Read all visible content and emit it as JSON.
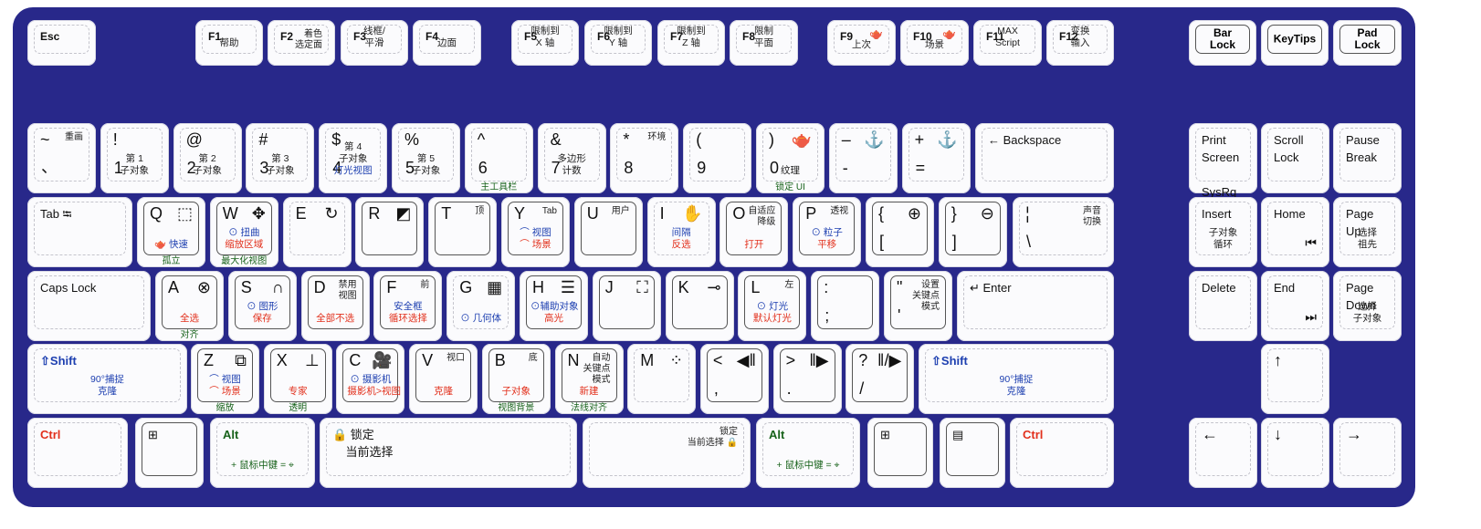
{
  "colors": {
    "board": "#28288a",
    "blue": "#1d3fb0",
    "red": "#e2301c",
    "green": "#17621a",
    "black": "#222222"
  },
  "icons": {
    "teapot": "🫖",
    "anchor": "⚓",
    "select": "⬚",
    "move": "✥",
    "rotate": "↻",
    "scale": "◩",
    "hand": "✋",
    "zoom-in": "⊕",
    "zoom-out": "⊖",
    "snap": "⊗",
    "magnet": "∩",
    "grid": "▦",
    "list-cursor": "☰",
    "brackets": "⛶",
    "key": "⊸",
    "box": "⧉",
    "axis": "⊥",
    "camera": "🎥",
    "windows": "⊞",
    "menu": "▤",
    "lock": "🔒",
    "orbit": "⌖",
    "prev-frame": "◀‖",
    "next-frame": "‖▶",
    "play": "‖/▶",
    "dots": "⁘",
    "home-skip": "⏮",
    "end-skip": "⏭"
  },
  "rows": [
    {
      "keys": [
        {
          "tl": "Esc"
        },
        {
          "tl": "F1",
          "mid": [
            {
              "t": "帮助",
              "c": "black"
            }
          ]
        },
        {
          "tl": "F2",
          "tr": "着色\n选定面"
        },
        {
          "tl": "F3",
          "mid": [
            {
              "t": "线框/",
              "c": "black"
            },
            {
              "t": "平滑",
              "c": "black"
            }
          ]
        },
        {
          "tl": "F4",
          "mid": [
            {
              "t": "边面",
              "c": "black"
            }
          ]
        },
        {
          "tl": "F5",
          "mid": [
            {
              "t": "限制到",
              "c": "black"
            },
            {
              "t": "X 轴",
              "c": "black"
            }
          ]
        },
        {
          "tl": "F6",
          "mid": [
            {
              "t": "限制到",
              "c": "black"
            },
            {
              "t": "Y 轴",
              "c": "black"
            }
          ]
        },
        {
          "tl": "F7",
          "mid": [
            {
              "t": "限制到",
              "c": "black"
            },
            {
              "t": "Z 轴",
              "c": "black"
            }
          ]
        },
        {
          "tl": "F8",
          "mid": [
            {
              "t": "限制",
              "c": "black"
            },
            {
              "t": "平面",
              "c": "black"
            }
          ]
        },
        {
          "tl": "F9",
          "icon": "teapot",
          "mid": [
            {
              "t": "上次",
              "c": "black"
            }
          ]
        },
        {
          "tl": "F10",
          "icon": "teapot",
          "mid": [
            {
              "t": "场景",
              "c": "black"
            }
          ]
        },
        {
          "tl": "F11",
          "mid": [
            {
              "t": "MAX",
              "c": "black"
            },
            {
              "t": "Script",
              "c": "black"
            }
          ]
        },
        {
          "tl": "F12",
          "mid": [
            {
              "t": "变换",
              "c": "black"
            },
            {
              "t": "输入",
              "c": "black"
            }
          ]
        },
        {
          "center": "Bar\nLock",
          "framed": true
        },
        {
          "center": "KeyTips",
          "framed": true
        },
        {
          "center": "Pad\nLock",
          "framed": true
        }
      ]
    },
    {
      "keys": [
        {
          "tl": "~",
          "bl": "、",
          "tr": "重画"
        },
        {
          "tl": "!",
          "bl": "1",
          "mid": [
            {
              "t": "第 1",
              "c": "black"
            },
            {
              "t": "子对象",
              "c": "black"
            }
          ]
        },
        {
          "tl": "@",
          "bl": "2",
          "mid": [
            {
              "t": "第 2",
              "c": "black"
            },
            {
              "t": "子对象",
              "c": "black"
            }
          ]
        },
        {
          "tl": "#",
          "bl": "3",
          "mid": [
            {
              "t": "第 3",
              "c": "black"
            },
            {
              "t": "子对象",
              "c": "black"
            }
          ]
        },
        {
          "tl": "$",
          "bl": "4",
          "mid": [
            {
              "t": "第 4",
              "c": "black"
            },
            {
              "t": "子对象",
              "c": "black"
            },
            {
              "t": "灯光视图",
              "c": "blue"
            }
          ]
        },
        {
          "tl": "%",
          "bl": "5",
          "mid": [
            {
              "t": "第 5",
              "c": "black"
            },
            {
              "t": "子对象",
              "c": "black"
            }
          ]
        },
        {
          "tl": "^",
          "bl": "6",
          "below": "主工具栏"
        },
        {
          "tl": "&",
          "bl": "7",
          "mid": [
            {
              "t": "多边形",
              "c": "black"
            },
            {
              "t": "计数",
              "c": "black"
            }
          ]
        },
        {
          "tl": "*",
          "bl": "8",
          "tr": "环境"
        },
        {
          "tl": "(",
          "bl": "9"
        },
        {
          "tl": ")",
          "bl": "0",
          "icon": "teapot",
          "mid": [
            {
              "t": "纹理",
              "c": "black"
            }
          ],
          "below": "锁定 UI"
        },
        {
          "tl": "–",
          "bl": "-",
          "icon": "anchor"
        },
        {
          "tl": "+",
          "bl": "=",
          "icon": "anchor"
        },
        {
          "tl": "← Backspace",
          "small": true
        },
        {
          "tl": "Print\nScreen\n\nSysRq",
          "small": true
        },
        {
          "tl": "Scroll\nLock",
          "small": true
        },
        {
          "tl": "Pause\nBreak",
          "small": true
        }
      ]
    },
    {
      "keys": [
        {
          "tl": "Tab ⭾",
          "small": true
        },
        {
          "tl": "Q",
          "icon": "select",
          "framed": true,
          "mid": [
            {
              "t": "🫖 快速",
              "c": "blue"
            }
          ],
          "below": "孤立"
        },
        {
          "tl": "W",
          "icon": "move",
          "framed": true,
          "mid": [
            {
              "t": "⊙ 扭曲",
              "c": "blue"
            },
            {
              "t": "缩放区域",
              "c": "red"
            }
          ],
          "below": "最大化视图"
        },
        {
          "tl": "E",
          "icon": "rotate"
        },
        {
          "tl": "R",
          "icon": "scale",
          "framed": true
        },
        {
          "tl": "T",
          "tr": "顶",
          "framed": true
        },
        {
          "tl": "Y",
          "tr": "Tab",
          "framed": true,
          "mid": [
            {
              "t": "⌒ 视图",
              "c": "blue"
            },
            {
              "t": "⌒ 场景",
              "c": "red"
            }
          ]
        },
        {
          "tl": "U",
          "tr": "用户",
          "framed": true
        },
        {
          "tl": "I",
          "icon": "hand",
          "mid": [
            {
              "t": "间隔",
              "c": "blue"
            },
            {
              "t": "反选",
              "c": "red"
            }
          ]
        },
        {
          "tl": "O",
          "tr": "自适应\n降级",
          "framed": true,
          "mid": [
            {
              "t": "打开",
              "c": "red"
            }
          ]
        },
        {
          "tl": "P",
          "tr": "透视",
          "framed": true,
          "mid": [
            {
              "t": "⊙ 粒子",
              "c": "blue"
            },
            {
              "t": "平移",
              "c": "red"
            }
          ]
        },
        {
          "tl": "{",
          "bl": "[",
          "icon": "zoom-in",
          "framed": true
        },
        {
          "tl": "}",
          "bl": "]",
          "icon": "zoom-out",
          "framed": true
        },
        {
          "tl": "¦",
          "bl": "\\",
          "tr": "声音\n切换"
        },
        {
          "tl": "Insert",
          "small": true,
          "mid": [
            {
              "t": "子对象",
              "c": "black"
            },
            {
              "t": "循环",
              "c": "black"
            }
          ]
        },
        {
          "tl": "Home",
          "small": true,
          "icon": "home-skip"
        },
        {
          "tl": "Page\nUp",
          "small": true,
          "mid": [
            {
              "t": "选择",
              "c": "black"
            },
            {
              "t": "祖先",
              "c": "black"
            }
          ]
        }
      ]
    },
    {
      "keys": [
        {
          "tl": "Caps Lock",
          "small": true
        },
        {
          "tl": "A",
          "icon": "snap",
          "framed": true,
          "mid": [
            {
              "t": "全选",
              "c": "red"
            }
          ],
          "below": "对齐"
        },
        {
          "tl": "S",
          "icon": "magnet",
          "framed": true,
          "mid": [
            {
              "t": "⊙ 图形",
              "c": "blue"
            },
            {
              "t": "保存",
              "c": "red"
            }
          ]
        },
        {
          "tl": "D",
          "tr": "禁用\n视图",
          "framed": true,
          "mid": [
            {
              "t": "全部不选",
              "c": "red"
            }
          ]
        },
        {
          "tl": "F",
          "tr": "前",
          "framed": true,
          "mid": [
            {
              "t": "安全框",
              "c": "blue"
            },
            {
              "t": "循环选择",
              "c": "red"
            }
          ]
        },
        {
          "tl": "G",
          "icon": "grid",
          "mid": [
            {
              "t": "⊙ 几何体",
              "c": "blue"
            }
          ]
        },
        {
          "tl": "H",
          "icon": "list-cursor",
          "framed": true,
          "mid": [
            {
              "t": "⊙辅助对象",
              "c": "blue"
            },
            {
              "t": "高光",
              "c": "red"
            }
          ]
        },
        {
          "tl": "J",
          "icon": "brackets",
          "framed": true
        },
        {
          "tl": "K",
          "icon": "key",
          "framed": true
        },
        {
          "tl": "L",
          "tr": "左",
          "framed": true,
          "mid": [
            {
              "t": "⊙ 灯光",
              "c": "blue"
            },
            {
              "t": "默认灯光",
              "c": "red"
            }
          ]
        },
        {
          "tl": ":",
          "bl": ";",
          "framed": true
        },
        {
          "tl": "\"",
          "bl": "'",
          "tr": "设置\n关键点\n模式",
          "framed": true
        },
        {
          "tl": "↵ Enter",
          "small": true
        },
        {
          "tl": "Delete",
          "small": true
        },
        {
          "tl": "End",
          "small": true,
          "icon": "end-skip"
        },
        {
          "tl": "Page\nDown",
          "small": true,
          "mid": [
            {
              "t": "选择",
              "c": "black"
            },
            {
              "t": "子对象",
              "c": "black"
            }
          ]
        }
      ]
    },
    {
      "keys": [
        {
          "tl": "⇧Shift",
          "small": true,
          "blue": true,
          "mid": [
            {
              "t": "90°捕捉",
              "c": "blue"
            },
            {
              "t": "克隆",
              "c": "blue"
            }
          ]
        },
        {
          "tl": "Z",
          "icon": "box",
          "framed": true,
          "mid": [
            {
              "t": "⌒ 视图",
              "c": "blue"
            },
            {
              "t": "⌒ 场景",
              "c": "red"
            }
          ],
          "below": "缩放"
        },
        {
          "tl": "X",
          "icon": "axis",
          "framed": true,
          "mid": [
            {
              "t": "专家",
              "c": "red"
            }
          ],
          "below": "透明"
        },
        {
          "tl": "C",
          "icon": "camera",
          "framed": true,
          "mid": [
            {
              "t": "⊙ 摄影机",
              "c": "blue"
            },
            {
              "t": "摄影机>视图",
              "c": "red"
            }
          ]
        },
        {
          "tl": "V",
          "tr": "视口",
          "framed": true,
          "mid": [
            {
              "t": "克隆",
              "c": "red"
            }
          ]
        },
        {
          "tl": "B",
          "tr": "底",
          "framed": true,
          "mid": [
            {
              "t": "子对象",
              "c": "red"
            }
          ],
          "below": "视图背景"
        },
        {
          "tl": "N",
          "tr": "自动\n关键点\n模式",
          "framed": true,
          "mid": [
            {
              "t": "新建",
              "c": "red"
            }
          ],
          "below": "法线对齐"
        },
        {
          "tl": "M",
          "icon": "dots"
        },
        {
          "tl": "<",
          "bl": ",",
          "icon": "prev-frame",
          "framed": true
        },
        {
          "tl": ">",
          "bl": ".",
          "icon": "next-frame",
          "framed": true
        },
        {
          "tl": "?",
          "bl": "/",
          "icon": "play",
          "framed": true
        },
        {
          "tl": "⇧Shift",
          "small": true,
          "blue": true,
          "mid": [
            {
              "t": "90°捕捉",
              "c": "blue"
            },
            {
              "t": "克隆",
              "c": "blue"
            }
          ]
        },
        {
          "tl": "↑"
        }
      ]
    },
    {
      "keys": [
        {
          "tl": "Ctrl",
          "small": true,
          "red": true
        },
        {
          "tl": "⊞",
          "small": true,
          "framed": true
        },
        {
          "tl": "Alt",
          "small": true,
          "green": true,
          "mid": [
            {
              "t": "+ 鼠标中键 = ⌖",
              "c": "green"
            }
          ]
        },
        {
          "tl": "🔒 锁定\n    当前选择",
          "small": true
        },
        {
          "tr": "锁定\n当前选择 🔒"
        },
        {
          "tl": "Alt",
          "small": true,
          "green": true,
          "mid": [
            {
              "t": "+ 鼠标中键 = ⌖",
              "c": "green"
            }
          ]
        },
        {
          "tl": "⊞",
          "small": true,
          "framed": true
        },
        {
          "tl": "▤",
          "small": true,
          "framed": true
        },
        {
          "tl": "Ctrl",
          "small": true,
          "red": true
        },
        {
          "tl": "←"
        },
        {
          "tl": "↓"
        },
        {
          "tl": "→"
        }
      ]
    }
  ]
}
